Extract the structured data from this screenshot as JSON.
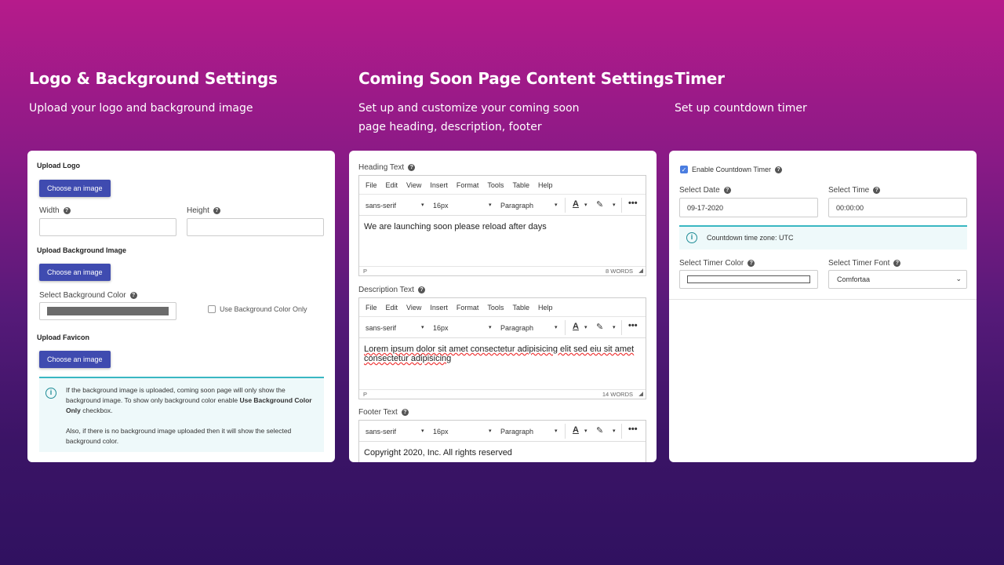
{
  "columns": [
    {
      "title": "Logo & Background Settings",
      "subtitle": "Upload your logo and background image"
    },
    {
      "title": "Coming Soon Page Content Settings",
      "subtitle": "Set up and customize your coming soon page heading, description, footer"
    },
    {
      "title": "Timer",
      "subtitle": "Set up countdown timer"
    }
  ],
  "logo_card": {
    "upload_logo": "Upload Logo",
    "choose_image": "Choose an image",
    "width_label": "Width",
    "height_label": "Height",
    "upload_bg": "Upload Background Image",
    "select_bg_color": "Select Background Color",
    "use_bg_color_only": "Use Background Color Only",
    "bg_color_value": "#6b6b6b",
    "upload_favicon": "Upload Favicon",
    "notice_1a": "If the background image is uploaded, coming soon page will only show the background image. To show only background color enable ",
    "notice_1b": "Use Background Color Only",
    "notice_1c": " checkbox.",
    "notice_2": "Also, if there is no background image uploaded then it will show the selected background color."
  },
  "content_card": {
    "heading_label": "Heading Text",
    "description_label": "Description Text",
    "footer_label": "Footer Text",
    "menu": [
      "File",
      "Edit",
      "View",
      "Insert",
      "Format",
      "Tools",
      "Table",
      "Help"
    ],
    "font_family": "sans-serif",
    "font_size": "16px",
    "block_format": "Paragraph",
    "heading_text": "We are launching soon please reload after days",
    "heading_words": "8 WORDS",
    "description_text": "Lorem ipsum dolor sit amet consectetur adipisicing elit sed eiu sit amet consectetur adipisicing",
    "description_words": "14 WORDS",
    "footer_text": "Copyright 2020, Inc. All rights reserved",
    "path_p": "P"
  },
  "timer_card": {
    "enable_label": "Enable Countdown Timer",
    "select_date": "Select Date",
    "date_value": "09-17-2020",
    "select_time": "Select Time",
    "time_value": "00:00:00",
    "timezone_note": "Countdown time zone: UTC",
    "select_timer_color": "Select Timer Color",
    "select_timer_font": "Select Timer Font",
    "font_value": "Comfortaa"
  }
}
